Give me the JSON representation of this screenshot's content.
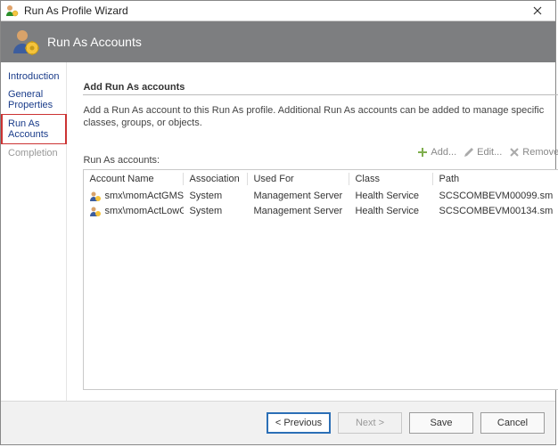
{
  "window": {
    "title": "Run As Profile Wizard",
    "banner_title": "Run As Accounts"
  },
  "sidebar": {
    "items": [
      {
        "label": "Introduction"
      },
      {
        "label": "General Properties"
      },
      {
        "label": "Run As Accounts"
      },
      {
        "label": "Completion"
      }
    ]
  },
  "main": {
    "heading": "Add Run As accounts",
    "description": "Add a Run As account to this Run As profile. Additional Run As accounts can be added to manage specific classes, groups, or objects.",
    "list_label": "Run As accounts:",
    "toolbar": {
      "add_label": "Add...",
      "edit_label": "Edit...",
      "remove_label": "Remove"
    },
    "columns": {
      "name": "Account Name",
      "association": "Association",
      "used_for": "Used For",
      "class": "Class",
      "path": "Path"
    },
    "rows": [
      {
        "name": "smx\\momActGMSA$",
        "association": "System",
        "used_for": "Management Server",
        "class": "Health Service",
        "path": "SCSCOMBEVM00099.sm"
      },
      {
        "name": "smx\\momActLowG",
        "association": "System",
        "used_for": "Management Server",
        "class": "Health Service",
        "path": "SCSCOMBEVM00134.sm"
      }
    ]
  },
  "footer": {
    "previous": "< Previous",
    "next": "Next >",
    "save": "Save",
    "cancel": "Cancel"
  }
}
